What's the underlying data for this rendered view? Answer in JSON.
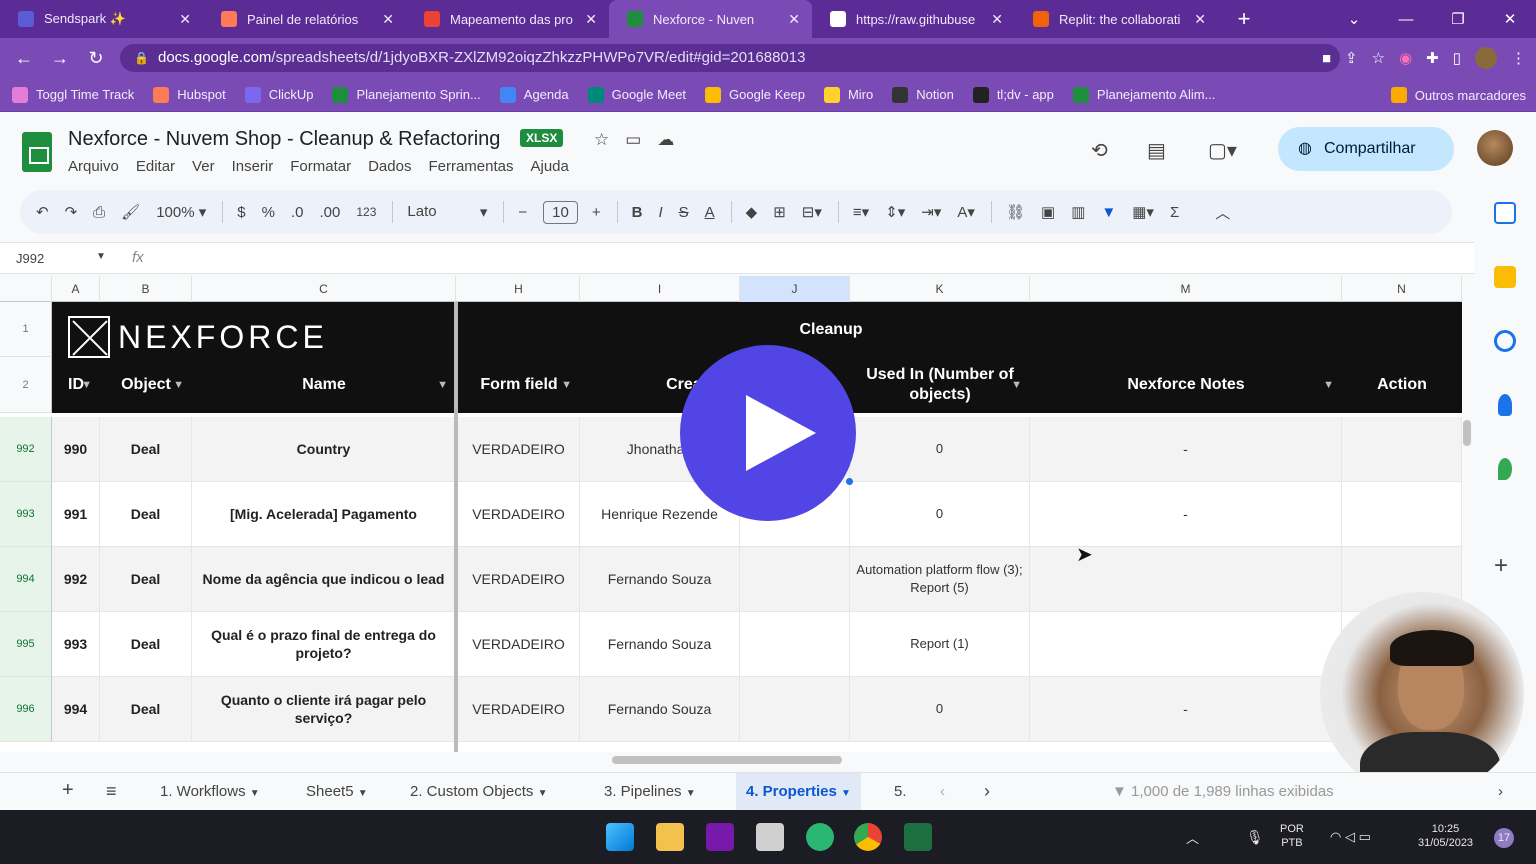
{
  "browser": {
    "tabs": [
      {
        "label": "Sendspark ✨",
        "color": "#5b5bd6"
      },
      {
        "label": "Painel de relatórios",
        "color": "#ff7a59"
      },
      {
        "label": "Mapeamento das pro",
        "color": "#ea4335"
      },
      {
        "label": "Nexforce - Nuven",
        "color": "#1e8e3e",
        "active": true
      },
      {
        "label": "https://raw.githubuse",
        "color": "#ffffff"
      },
      {
        "label": "Replit: the collaborati",
        "color": "#f26207"
      }
    ],
    "url_domain": "docs.google.com",
    "url_path": "/spreadsheets/d/1jdyoBXR-ZXlZM92oiqzZhkzzPHWPo7VR/edit#gid=201688013",
    "bookmarks": [
      {
        "label": "Toggl Time Track",
        "color": "#e57cd8"
      },
      {
        "label": "Hubspot",
        "color": "#ff7a59"
      },
      {
        "label": "ClickUp",
        "color": "#7b68ee"
      },
      {
        "label": "Planejamento Sprin...",
        "color": "#1e8e3e"
      },
      {
        "label": "Agenda",
        "color": "#4285f4"
      },
      {
        "label": "Google Meet",
        "color": "#00897b"
      },
      {
        "label": "Google Keep",
        "color": "#fbbc04"
      },
      {
        "label": "Miro",
        "color": "#ffd02f"
      },
      {
        "label": "Notion",
        "color": "#333333"
      },
      {
        "label": "tl;dv - app",
        "color": "#222222"
      },
      {
        "label": "Planejamento Alim...",
        "color": "#1e8e3e"
      }
    ],
    "other_bookmarks": "Outros marcadores"
  },
  "app": {
    "title": "Nexforce - Nuvem Shop - Cleanup & Refactoring",
    "badge": "XLSX",
    "menus": [
      "Arquivo",
      "Editar",
      "Ver",
      "Inserir",
      "Formatar",
      "Dados",
      "Ferramentas",
      "Ajuda"
    ],
    "share_label": "Compartilhar"
  },
  "toolbar": {
    "zoom": "100%",
    "currency": "$",
    "percent": "%",
    "dec_minus": ".0",
    "dec_plus": ".00",
    "num_format": "123",
    "font": "Lato",
    "font_size": "10"
  },
  "formula_bar": {
    "name_box": "J992",
    "fx": "fx"
  },
  "columns": [
    {
      "letter": "A"
    },
    {
      "letter": "B"
    },
    {
      "letter": "C"
    },
    {
      "letter": "H"
    },
    {
      "letter": "I"
    },
    {
      "letter": "J"
    },
    {
      "letter": "K"
    },
    {
      "letter": "M"
    },
    {
      "letter": "N"
    }
  ],
  "sheet_header": {
    "row1_nums": "1",
    "row2_nums": "2",
    "logo_text": "NEXFORCE",
    "cleanup": "Cleanup",
    "headers": [
      "ID",
      "Object",
      "Name",
      "Form field",
      "Created user",
      "Used In (Number of objects)",
      "Nexforce Notes",
      "Action"
    ]
  },
  "rows": [
    {
      "rownum": "992",
      "id": "990",
      "object": "Deal",
      "name": "Country",
      "form_field": "VERDADEIRO",
      "created_user": "Jhonathan",
      "used_in": "0",
      "notes": "-"
    },
    {
      "rownum": "993",
      "id": "991",
      "object": "Deal",
      "name": "[Mig. Acelerada] Pagamento",
      "form_field": "VERDADEIRO",
      "created_user": "Henrique Rezende",
      "used_in": "0",
      "notes": "-"
    },
    {
      "rownum": "994",
      "id": "992",
      "object": "Deal",
      "name": "Nome da agência que indicou o lead",
      "form_field": "VERDADEIRO",
      "created_user": "Fernando Souza",
      "used_in": "Automation platform flow (3); Report (5)",
      "notes": ""
    },
    {
      "rownum": "995",
      "id": "993",
      "object": "Deal",
      "name": "Qual é o prazo final de entrega do projeto?",
      "form_field": "VERDADEIRO",
      "created_user": "Fernando Souza",
      "used_in": "Report (1)",
      "notes": ""
    },
    {
      "rownum": "996",
      "id": "994",
      "object": "Deal",
      "name": "Quanto o cliente irá pagar pelo serviço?",
      "form_field": "VERDADEIRO",
      "created_user": "Fernando Souza",
      "used_in": "0",
      "notes": "-"
    }
  ],
  "sheet_tabs": [
    "1. Workflows",
    "Sheet5",
    "2. Custom Objects",
    "3. Pipelines",
    "4. Properties",
    "5."
  ],
  "row_count": "1,000 de 1,989 linhas exibidas",
  "taskbar": {
    "lang_top": "POR",
    "lang_bottom": "PTB",
    "time": "10:25",
    "date": "31/05/2023",
    "notif": "17"
  }
}
